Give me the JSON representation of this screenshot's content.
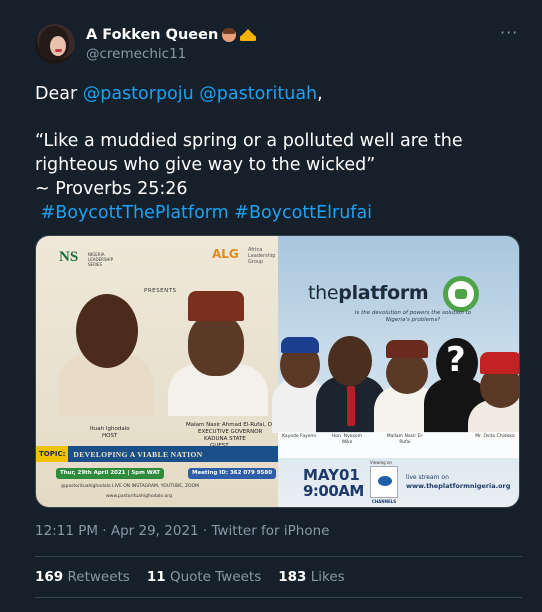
{
  "author": {
    "display_name": "A Fokken Queen",
    "handle": "@cremechic11",
    "emojis": [
      "woman-emoji",
      "crown-emoji"
    ]
  },
  "tweet": {
    "greeting": "Dear ",
    "mention_1": "@pastorpoju",
    "mention_2": "@pastorituah",
    "greeting_end": ",",
    "quote_line_1": "“Like a muddied spring or a polluted well are the",
    "quote_line_2": "righteous who give way to the wicked”",
    "quote_ref": "~ Proverbs 25:26",
    "hashtag_1": "#BoycottThePlatform",
    "hashtag_2": "#BoycottElrufai"
  },
  "media_left": {
    "ns_logo": "NS",
    "ns_logo_sub": "NIGERIA LEADERSHIP SERIES",
    "alg_logo": "ALG",
    "alg_logo_sub": "Africa Leadership Group",
    "presents": "PRESENTS",
    "host_name": "Ituah Ighodalo",
    "host_role": "HOST",
    "guest_name": "Malam Nasir Ahmad El-Rufai, OFR",
    "guest_role_1": "EXECUTIVE GOVERNOR",
    "guest_role_2": "KADUNA STATE",
    "guest_role_3": "GUEST",
    "topic_tag": "TOPIC:",
    "topic": "DEVELOPING A VIABLE NATION",
    "date": "Thur, 29th April 2021 | 5pm WAT",
    "meeting_id": "Meeting ID: 362 079 9580",
    "social": "@pastorituahighodalo  LIVE ON INSTAGRAM, YOUTUBE, ZOOM",
    "website": "www.pastorituahighodalo.org"
  },
  "media_right": {
    "brand_the": "the",
    "brand_platform": "platform",
    "subtitle": "Is the devolution of powers the solution to Nigeria's problems?",
    "speaker_1": "Kayode Fayemi",
    "speaker_2": "Hon. Nyesom Wike",
    "speaker_3": "Mallam Nasir El-Rufai",
    "speaker_4": "?",
    "speaker_5": "Mr. Osita Chidoka",
    "event_date": "MAY01",
    "event_time": "9:00AM",
    "viewing_on": "Viewing on",
    "channel": "CHANNELS",
    "stream_label": "live stream on",
    "stream_url": "www.theplatformnigeria.org"
  },
  "meta": {
    "timestamp": "12:11 PM · Apr 29, 2021 · Twitter for iPhone"
  },
  "stats": {
    "retweets_count": "169",
    "retweets_label": "Retweets",
    "quotes_count": "11",
    "quotes_label": "Quote Tweets",
    "likes_count": "183",
    "likes_label": "Likes"
  }
}
